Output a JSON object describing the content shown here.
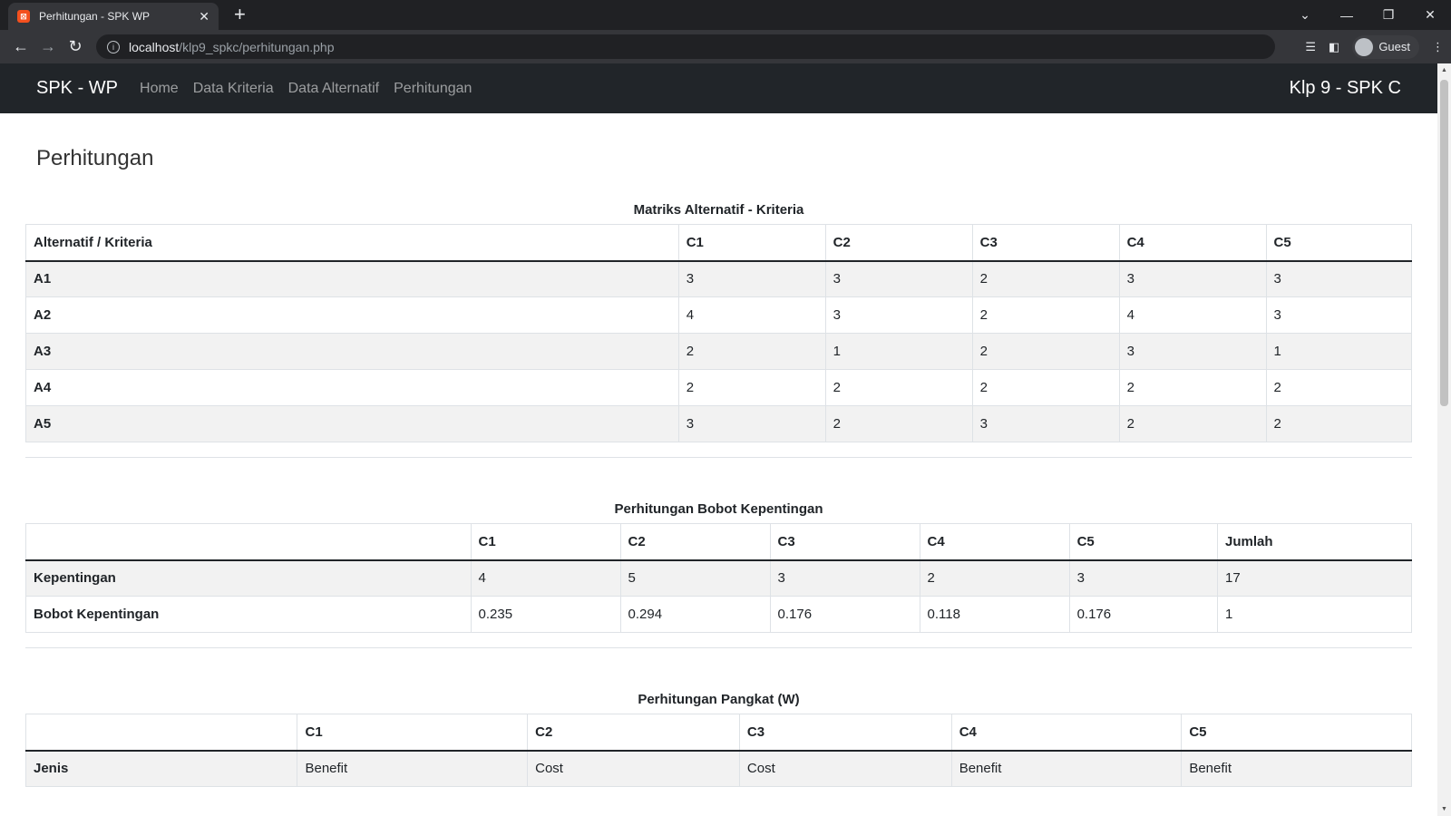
{
  "browser": {
    "tab_title": "Perhitungan - SPK WP",
    "favicon_text": "⊠",
    "new_tab": "+",
    "url_host": "localhost",
    "url_path": "/klp9_spkc/perhitungan.php",
    "profile": "Guest"
  },
  "navbar": {
    "brand": "SPK - WP",
    "links": [
      "Home",
      "Data Kriteria",
      "Data Alternatif",
      "Perhitungan"
    ],
    "right_text": "Klp 9 - SPK C"
  },
  "page_title": "Perhitungan",
  "matrix": {
    "caption": "Matriks Alternatif - Kriteria",
    "header": [
      "Alternatif / Kriteria",
      "C1",
      "C2",
      "C3",
      "C4",
      "C5"
    ],
    "rows": [
      [
        "A1",
        "3",
        "3",
        "2",
        "3",
        "3"
      ],
      [
        "A2",
        "4",
        "3",
        "2",
        "4",
        "3"
      ],
      [
        "A3",
        "2",
        "1",
        "2",
        "3",
        "1"
      ],
      [
        "A4",
        "2",
        "2",
        "2",
        "2",
        "2"
      ],
      [
        "A5",
        "3",
        "2",
        "3",
        "2",
        "2"
      ]
    ]
  },
  "bobot": {
    "caption": "Perhitungan Bobot Kepentingan",
    "header": [
      "",
      "C1",
      "C2",
      "C3",
      "C4",
      "C5",
      "Jumlah"
    ],
    "rows": [
      [
        "Kepentingan",
        "4",
        "5",
        "3",
        "2",
        "3",
        "17"
      ],
      [
        "Bobot Kepentingan",
        "0.235",
        "0.294",
        "0.176",
        "0.118",
        "0.176",
        "1"
      ]
    ]
  },
  "pangkat": {
    "caption": "Perhitungan Pangkat (W)",
    "header": [
      "",
      "C1",
      "C2",
      "C3",
      "C4",
      "C5"
    ],
    "rows": [
      [
        "Jenis",
        "Benefit",
        "Cost",
        "Cost",
        "Benefit",
        "Benefit"
      ]
    ]
  }
}
